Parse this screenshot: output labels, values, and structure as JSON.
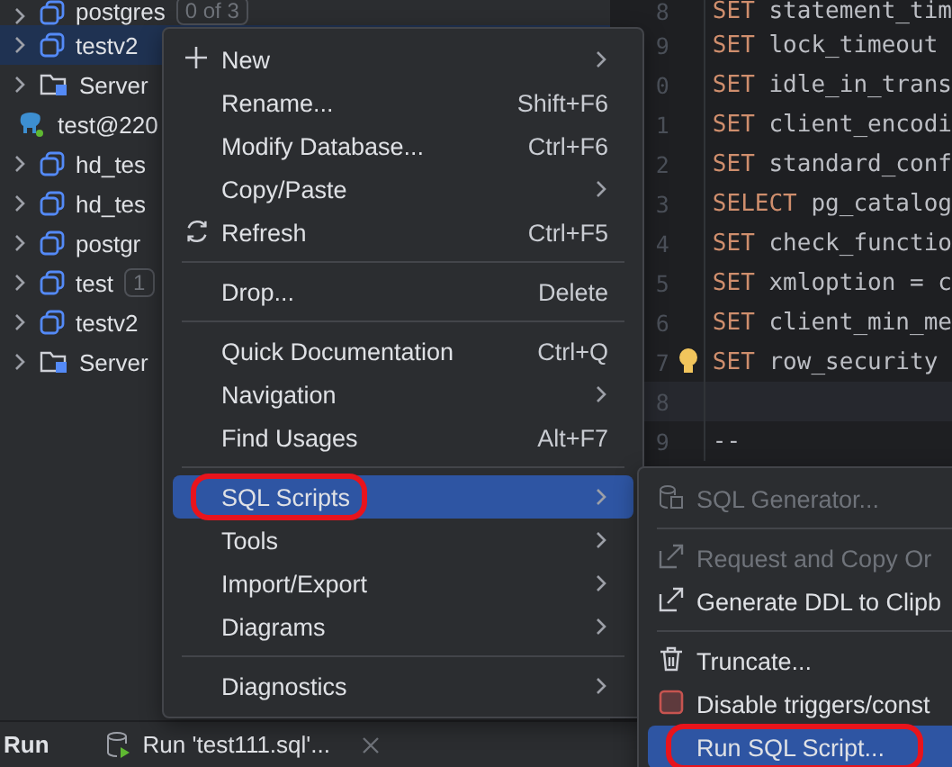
{
  "tree": {
    "items": [
      {
        "kind": "database",
        "label": "postgres",
        "badge": "0 of 3",
        "selected": false
      },
      {
        "kind": "database",
        "label": "testv2",
        "selected": true
      },
      {
        "kind": "folder",
        "label": "Server",
        "selected": false
      },
      {
        "kind": "connection",
        "label": "test@220",
        "selected": false,
        "children": [
          {
            "kind": "database",
            "label": "hd_tes",
            "selected": false
          },
          {
            "kind": "database",
            "label": "hd_tes",
            "selected": false
          },
          {
            "kind": "database",
            "label": "postgr",
            "selected": false
          },
          {
            "kind": "database",
            "label": "test",
            "badge": "1",
            "selected": false
          },
          {
            "kind": "database",
            "label": "testv2",
            "selected": false
          },
          {
            "kind": "folder",
            "label": "Server",
            "selected": false
          }
        ]
      }
    ]
  },
  "editor": {
    "lines": [
      {
        "number": "8",
        "keyword": "SET",
        "text": "statement_tim",
        "current": false,
        "bulb": false
      },
      {
        "number": "9",
        "keyword": "SET",
        "text": "lock_timeout",
        "current": false,
        "bulb": false
      },
      {
        "number": "0",
        "keyword": "SET",
        "text": "idle_in_trans",
        "current": false,
        "bulb": false
      },
      {
        "number": "1",
        "keyword": "SET",
        "text": "client_encodi",
        "current": false,
        "bulb": false
      },
      {
        "number": "2",
        "keyword": "SET",
        "text": "standard_conf",
        "current": false,
        "bulb": false
      },
      {
        "number": "3",
        "keyword": "SELECT",
        "text": "pg_catalog",
        "current": false,
        "bulb": false
      },
      {
        "number": "4",
        "keyword": "SET",
        "text": "check_functio",
        "current": false,
        "bulb": false
      },
      {
        "number": "5",
        "keyword": "SET",
        "text": "xmloption = c",
        "current": false,
        "bulb": false
      },
      {
        "number": "6",
        "keyword": "SET",
        "text": "client_min_me",
        "current": false,
        "bulb": false
      },
      {
        "number": "7",
        "keyword": "SET",
        "text": "row_security",
        "current": false,
        "bulb": true
      },
      {
        "number": "8",
        "current": true,
        "bulb": false
      },
      {
        "number": "9",
        "text": "--",
        "current": false,
        "bulb": false
      }
    ]
  },
  "context_menu": {
    "items": [
      {
        "kind": "item",
        "label": "New",
        "submenu": true,
        "selected": false,
        "annotated": false
      },
      {
        "kind": "item",
        "label": "Rename...",
        "shortcut": "Shift+F6",
        "submenu": false,
        "selected": false,
        "annotated": false
      },
      {
        "kind": "item",
        "label": "Modify Database...",
        "shortcut": "Ctrl+F6",
        "submenu": false,
        "selected": false,
        "annotated": false
      },
      {
        "kind": "item",
        "label": "Copy/Paste",
        "submenu": true,
        "selected": false,
        "annotated": false
      },
      {
        "kind": "item",
        "label": "Refresh",
        "shortcut": "Ctrl+F5",
        "submenu": false,
        "selected": false,
        "annotated": false
      },
      {
        "kind": "separator"
      },
      {
        "kind": "item",
        "label": "Drop...",
        "shortcut": "Delete",
        "submenu": false,
        "selected": false,
        "annotated": false
      },
      {
        "kind": "separator"
      },
      {
        "kind": "item",
        "label": "Quick Documentation",
        "shortcut": "Ctrl+Q",
        "submenu": false,
        "selected": false,
        "annotated": false
      },
      {
        "kind": "item",
        "label": "Navigation",
        "submenu": true,
        "selected": false,
        "annotated": false
      },
      {
        "kind": "item",
        "label": "Find Usages",
        "shortcut": "Alt+F7",
        "submenu": false,
        "selected": false,
        "annotated": false
      },
      {
        "kind": "separator"
      },
      {
        "kind": "item",
        "label": "SQL Scripts",
        "submenu": true,
        "selected": true,
        "annotated": true
      },
      {
        "kind": "item",
        "label": "Tools",
        "submenu": true,
        "selected": false,
        "annotated": false
      },
      {
        "kind": "item",
        "label": "Import/Export",
        "submenu": true,
        "selected": false,
        "annotated": false
      },
      {
        "kind": "item",
        "label": "Diagrams",
        "submenu": true,
        "selected": false,
        "annotated": false
      },
      {
        "kind": "separator"
      },
      {
        "kind": "item",
        "label": "Diagnostics",
        "submenu": true,
        "selected": false,
        "annotated": false
      }
    ]
  },
  "submenu": {
    "items": [
      {
        "kind": "item",
        "label": "SQL Generator...",
        "disabled": true,
        "selected": false,
        "annotated": false
      },
      {
        "kind": "separator"
      },
      {
        "kind": "item",
        "label": "Request and Copy Or",
        "disabled": true,
        "selected": false,
        "annotated": false
      },
      {
        "kind": "item",
        "label": "Generate DDL to Clipb",
        "disabled": false,
        "selected": false,
        "annotated": false
      },
      {
        "kind": "separator"
      },
      {
        "kind": "item",
        "label": "Truncate...",
        "disabled": false,
        "selected": false,
        "annotated": false
      },
      {
        "kind": "item",
        "label": "Disable triggers/const",
        "disabled": false,
        "selected": false,
        "annotated": false
      },
      {
        "kind": "item",
        "label": "Run SQL Script...",
        "disabled": false,
        "selected": true,
        "annotated": true
      }
    ]
  },
  "bottom_bar": {
    "title": "Run",
    "tab": "Run 'test111.sql'..."
  }
}
